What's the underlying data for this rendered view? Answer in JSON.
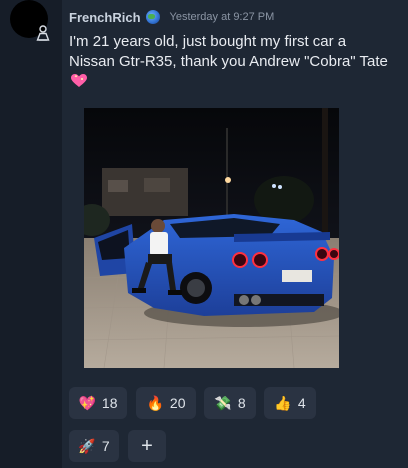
{
  "message": {
    "username": "FrenchRich",
    "timestamp": "Yesterday at 9:27 PM",
    "text": "I'm 21 years old, just bought my first car a Nissan Gtr-R35, thank you Andrew \"Cobra\" Tate"
  },
  "reactions": [
    {
      "emoji": "💖",
      "count": "18",
      "icon": "sparkling-heart-icon"
    },
    {
      "emoji": "🔥",
      "count": "20",
      "icon": "fire-icon"
    },
    {
      "emoji": "💸",
      "count": "8",
      "icon": "money-wings-icon"
    },
    {
      "emoji": "👍",
      "count": "4",
      "icon": "thumbs-up-icon"
    },
    {
      "emoji": "🚀",
      "count": "7",
      "icon": "rocket-icon"
    }
  ],
  "add_reaction_label": "+"
}
